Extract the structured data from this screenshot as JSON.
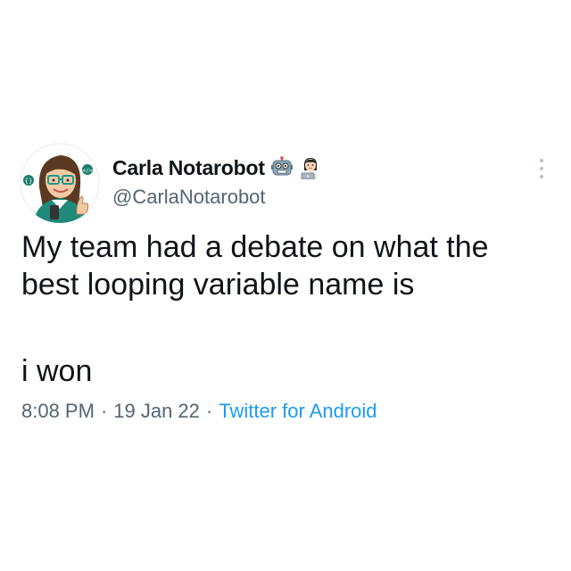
{
  "author": {
    "display_name": "Carla Notarobot",
    "handle": "@CarlaNotarobot",
    "badges": [
      "robot-emoji",
      "woman-technologist-emoji"
    ]
  },
  "tweet": {
    "text_line1": "My team had a debate on what the",
    "text_line2": "best looping variable name is",
    "text_punchline": "i won",
    "time": "8:08 PM",
    "separator": "·",
    "date": "19 Jan 22",
    "source": "Twitter for Android"
  },
  "icons": {
    "more": "more-vertical-icon",
    "avatar": "avatar"
  },
  "colors": {
    "text": "#0f1419",
    "secondary": "#536471",
    "link": "#1d9bf0"
  }
}
